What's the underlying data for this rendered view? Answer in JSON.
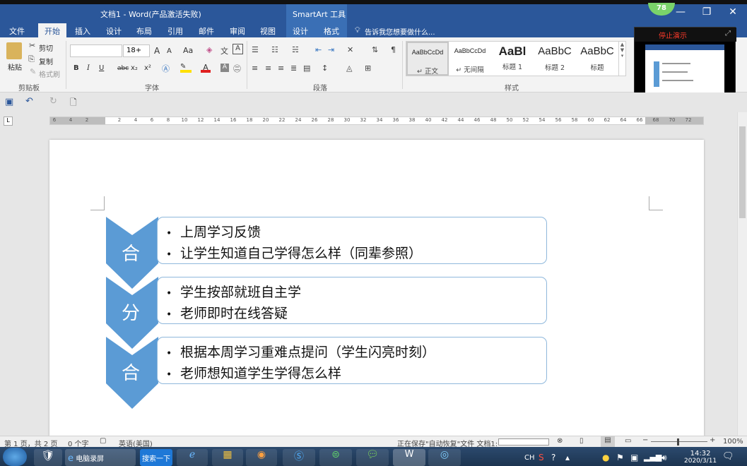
{
  "window": {
    "title": "文档1 - Word(产品激活失败)",
    "context_tab_group": "SmartArt 工具",
    "timer_badge": "78",
    "minimize": "—",
    "restore": "❐",
    "close": "✕"
  },
  "tabs": [
    "文件",
    "开始",
    "插入",
    "设计",
    "布局",
    "引用",
    "邮件",
    "审阅",
    "视图",
    "设计",
    "格式"
  ],
  "tell_me": "告诉我您想要做什么...",
  "clipboard": {
    "paste": "粘贴",
    "cut": "剪切",
    "copy": "复制",
    "format_painter": "格式刷",
    "group_label": "剪贴板"
  },
  "font": {
    "name": "",
    "size": "18+",
    "group_label": "字体",
    "grow": "A",
    "shrink": "A",
    "case": "Aa",
    "bold": "B",
    "italic": "I",
    "underline": "U",
    "strike": "abc",
    "subscript": "x₂",
    "superscript": "x²"
  },
  "paragraph": {
    "group_label": "段落"
  },
  "styles": {
    "group_label": "样式",
    "items": [
      {
        "preview": "AaBbCcDd",
        "name": "↵ 正文"
      },
      {
        "preview": "AaBbCcDd",
        "name": "↵ 无间隔"
      },
      {
        "preview": "AaBl",
        "name": "标题 1"
      },
      {
        "preview": "AaBbC",
        "name": "标题 2"
      },
      {
        "preview": "AaBbC",
        "name": "标题"
      }
    ]
  },
  "recorder": {
    "stop_label": "停止演示"
  },
  "ruler": {
    "ticks": [
      "6",
      "4",
      "2",
      "",
      "2",
      "4",
      "6",
      "8",
      "10",
      "12",
      "14",
      "16",
      "18",
      "20",
      "22",
      "24",
      "26",
      "28",
      "30",
      "32",
      "34",
      "36",
      "38",
      "40",
      "42",
      "44",
      "46",
      "48",
      "50",
      "52",
      "54",
      "56",
      "58",
      "60",
      "62",
      "64",
      "66",
      "68",
      "70",
      "72"
    ]
  },
  "smartart": {
    "sections": [
      {
        "label": "合",
        "bullets": [
          "上周学习反馈",
          "让学生知道自己学得怎么样（同辈参照）"
        ]
      },
      {
        "label": "分",
        "bullets": [
          "学生按部就班自主学",
          "老师即时在线答疑"
        ]
      },
      {
        "label": "合",
        "bullets": [
          "根据本周学习重难点提问（学生闪亮时刻）",
          "老师想知道学生学得怎么样"
        ]
      }
    ],
    "chevron_color": "#5b9bd5",
    "box_border_color": "#8fb8dc"
  },
  "statusbar": {
    "page": "第 1 页，共 2 页",
    "words": "0 个字",
    "language": "英语(美国)",
    "saving": "正在保存\"自动恢复\"文件 文档1:",
    "zoom": "100%"
  },
  "taskbar": {
    "ie_label": "电脑录屏",
    "search_label": "搜索一下",
    "ime": "CH",
    "time": "14:32",
    "date": "2020/3/11"
  }
}
